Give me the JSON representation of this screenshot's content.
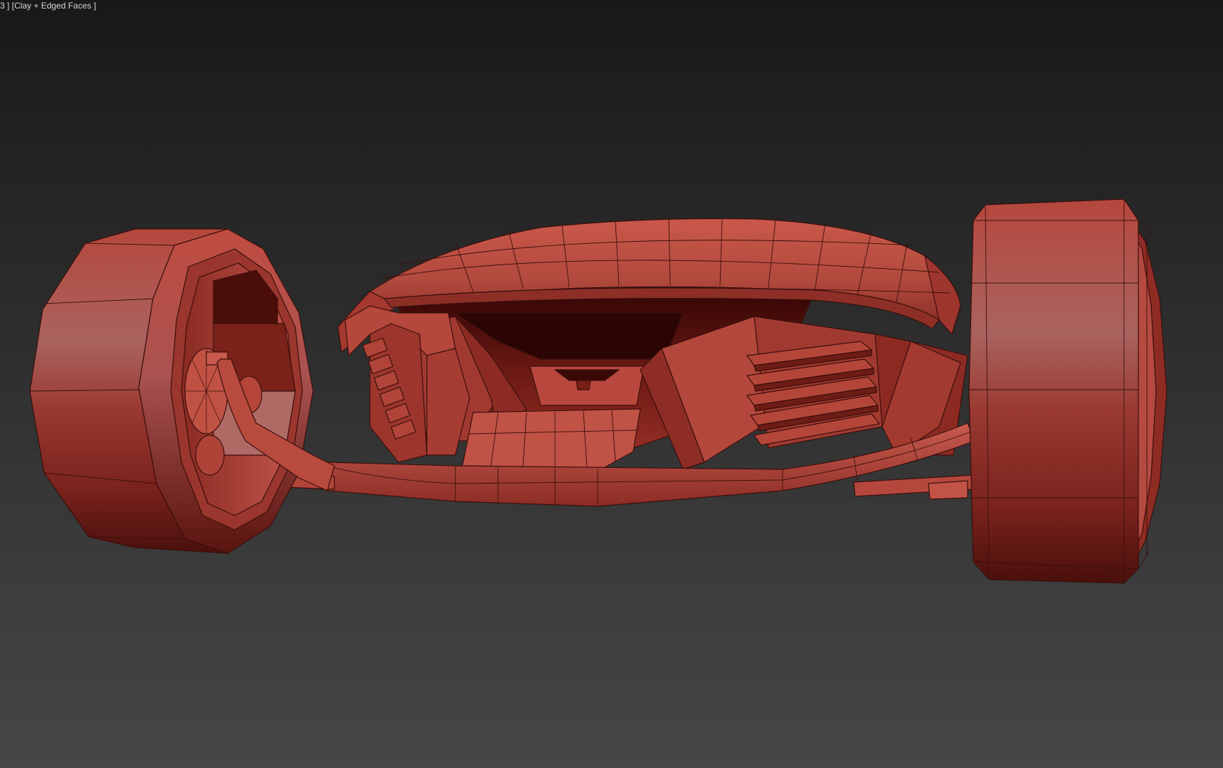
{
  "viewport": {
    "label": "3 ] [Clay + Edged Faces ]",
    "shading_mode": "Clay + Edged Faces"
  },
  "model": {
    "object": "hot-rod-car-model",
    "base_color": "#b5473c",
    "edge_color": "#3a0f0c"
  }
}
